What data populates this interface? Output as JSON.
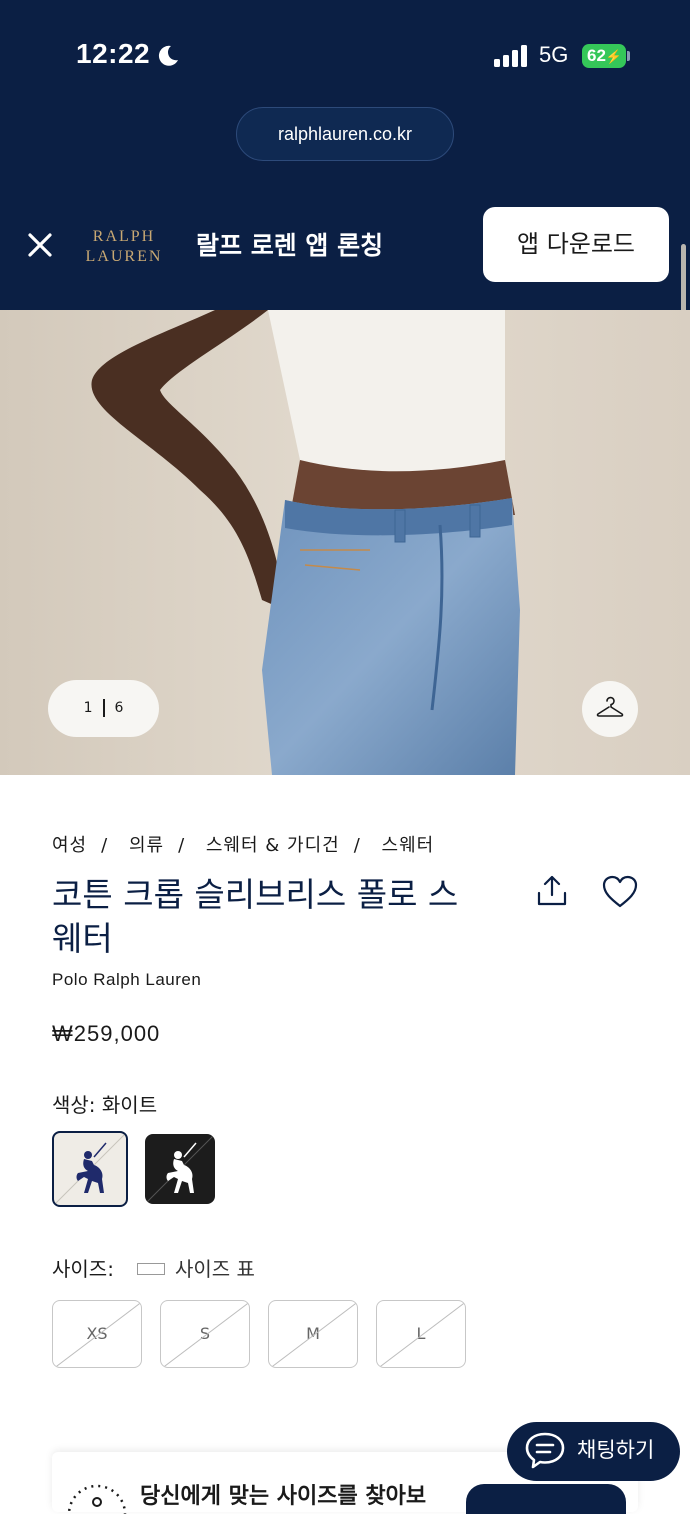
{
  "status_bar": {
    "time": "12:22",
    "network": "5G",
    "battery": "62"
  },
  "browser": {
    "url": "ralphlauren.co.kr"
  },
  "app_banner": {
    "logo_line1": "RALPH",
    "logo_line2": "LAUREN",
    "title": "랄프 로렌 앱 론칭",
    "download_label": "앱 다운로드"
  },
  "gallery": {
    "current": "1",
    "total": "6"
  },
  "breadcrumb": [
    "여성",
    "의류",
    "스웨터 & 가디건",
    "스웨터"
  ],
  "product": {
    "title": "코튼 크롭 슬리브리스 폴로 스웨터",
    "brand": "Polo Ralph Lauren",
    "price": "₩259,000",
    "color_label": "색상:",
    "color_value": "화이트"
  },
  "swatches": [
    {
      "name": "화이트",
      "selected": true,
      "bg": "#efece6",
      "pony": "#1f2a6b"
    },
    {
      "name": "블랙",
      "selected": false,
      "bg": "#1c1c1c",
      "pony": "#ffffff"
    }
  ],
  "sizes": {
    "label": "사이즈:",
    "chart_label": "사이즈 표",
    "options": [
      {
        "label": "XS",
        "available": false
      },
      {
        "label": "S",
        "available": false
      },
      {
        "label": "M",
        "available": false
      },
      {
        "label": "L",
        "available": false
      }
    ]
  },
  "fit_finder": {
    "text": "당신에게 맞는 사이즈를 찾아보"
  },
  "chat": {
    "label": "채팅하기"
  },
  "colors": {
    "navy": "#0b1f44",
    "gold": "#c8a873",
    "battery_green": "#35c759"
  }
}
